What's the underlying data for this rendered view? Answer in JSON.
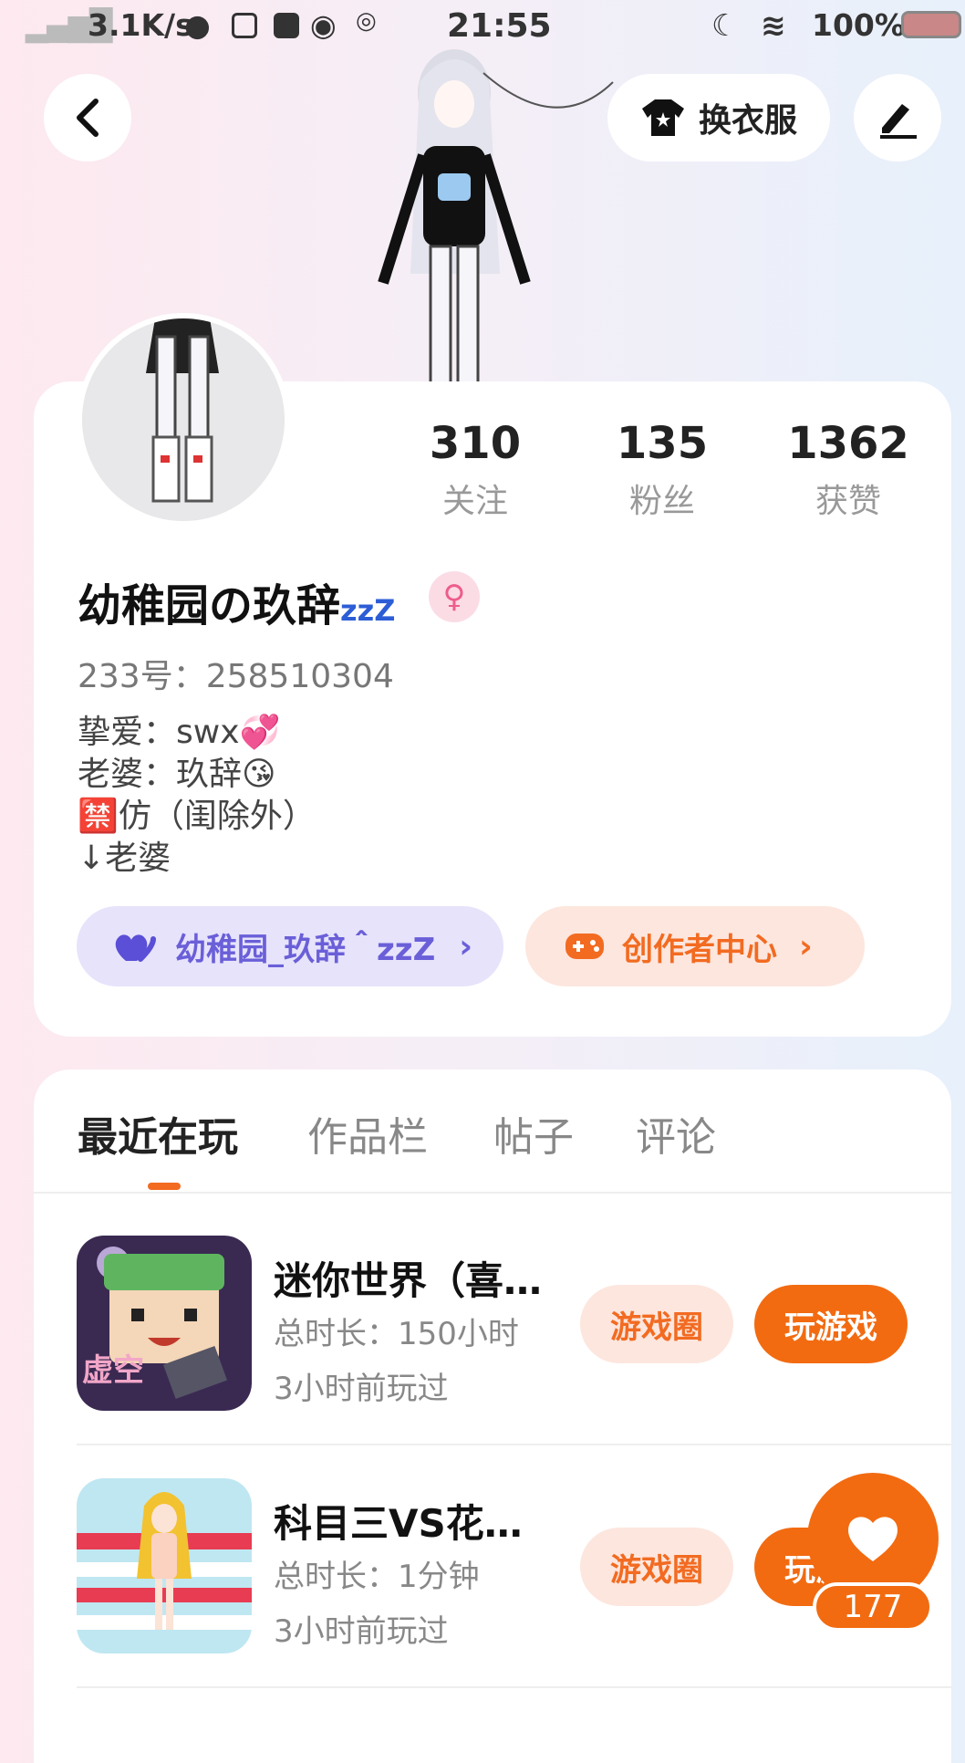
{
  "status_bar": {
    "net_speed": "3.1K/s",
    "time": "21:55",
    "battery": "100%"
  },
  "header": {
    "back_icon": "back-chevron-icon",
    "dress_up_label": "换衣服",
    "edit_icon": "pen-icon"
  },
  "profile": {
    "stats": [
      {
        "num": "310",
        "label": "关注"
      },
      {
        "num": "135",
        "label": "粉丝"
      },
      {
        "num": "1362",
        "label": "获赞"
      }
    ],
    "nickname": "幼稚园の玖辞",
    "nickname_suffix": "zzZ",
    "gender_symbol": "♀",
    "uid": "233号：258510304",
    "bio": [
      "挚爱：swx💞",
      "老婆：玖辞😘",
      "🈲仿（闺除外）",
      "↓老婆"
    ],
    "chip_left": "幼稚园_玖辞＾zzZ",
    "chip_right": "创作者中心"
  },
  "tabs": [
    "最近在玩",
    "作品栏",
    "帖子",
    "评论"
  ],
  "games": [
    {
      "title": "迷你世界（喜…",
      "duration": "总时长：150小时",
      "last_played": "3小时前玩过",
      "circle_btn": "游戏圈",
      "play_btn": "玩游戏",
      "thumb_text": "虚空"
    },
    {
      "title": "科目三VS花…",
      "duration": "总时长：1分钟",
      "last_played": "3小时前玩过",
      "circle_btn": "游戏圈",
      "play_btn": "玩游戏"
    }
  ],
  "fab": {
    "count": "177",
    "icon": "heart-icon"
  },
  "colors": {
    "accent": "#f26b11",
    "purple": "#6a5fd8"
  }
}
